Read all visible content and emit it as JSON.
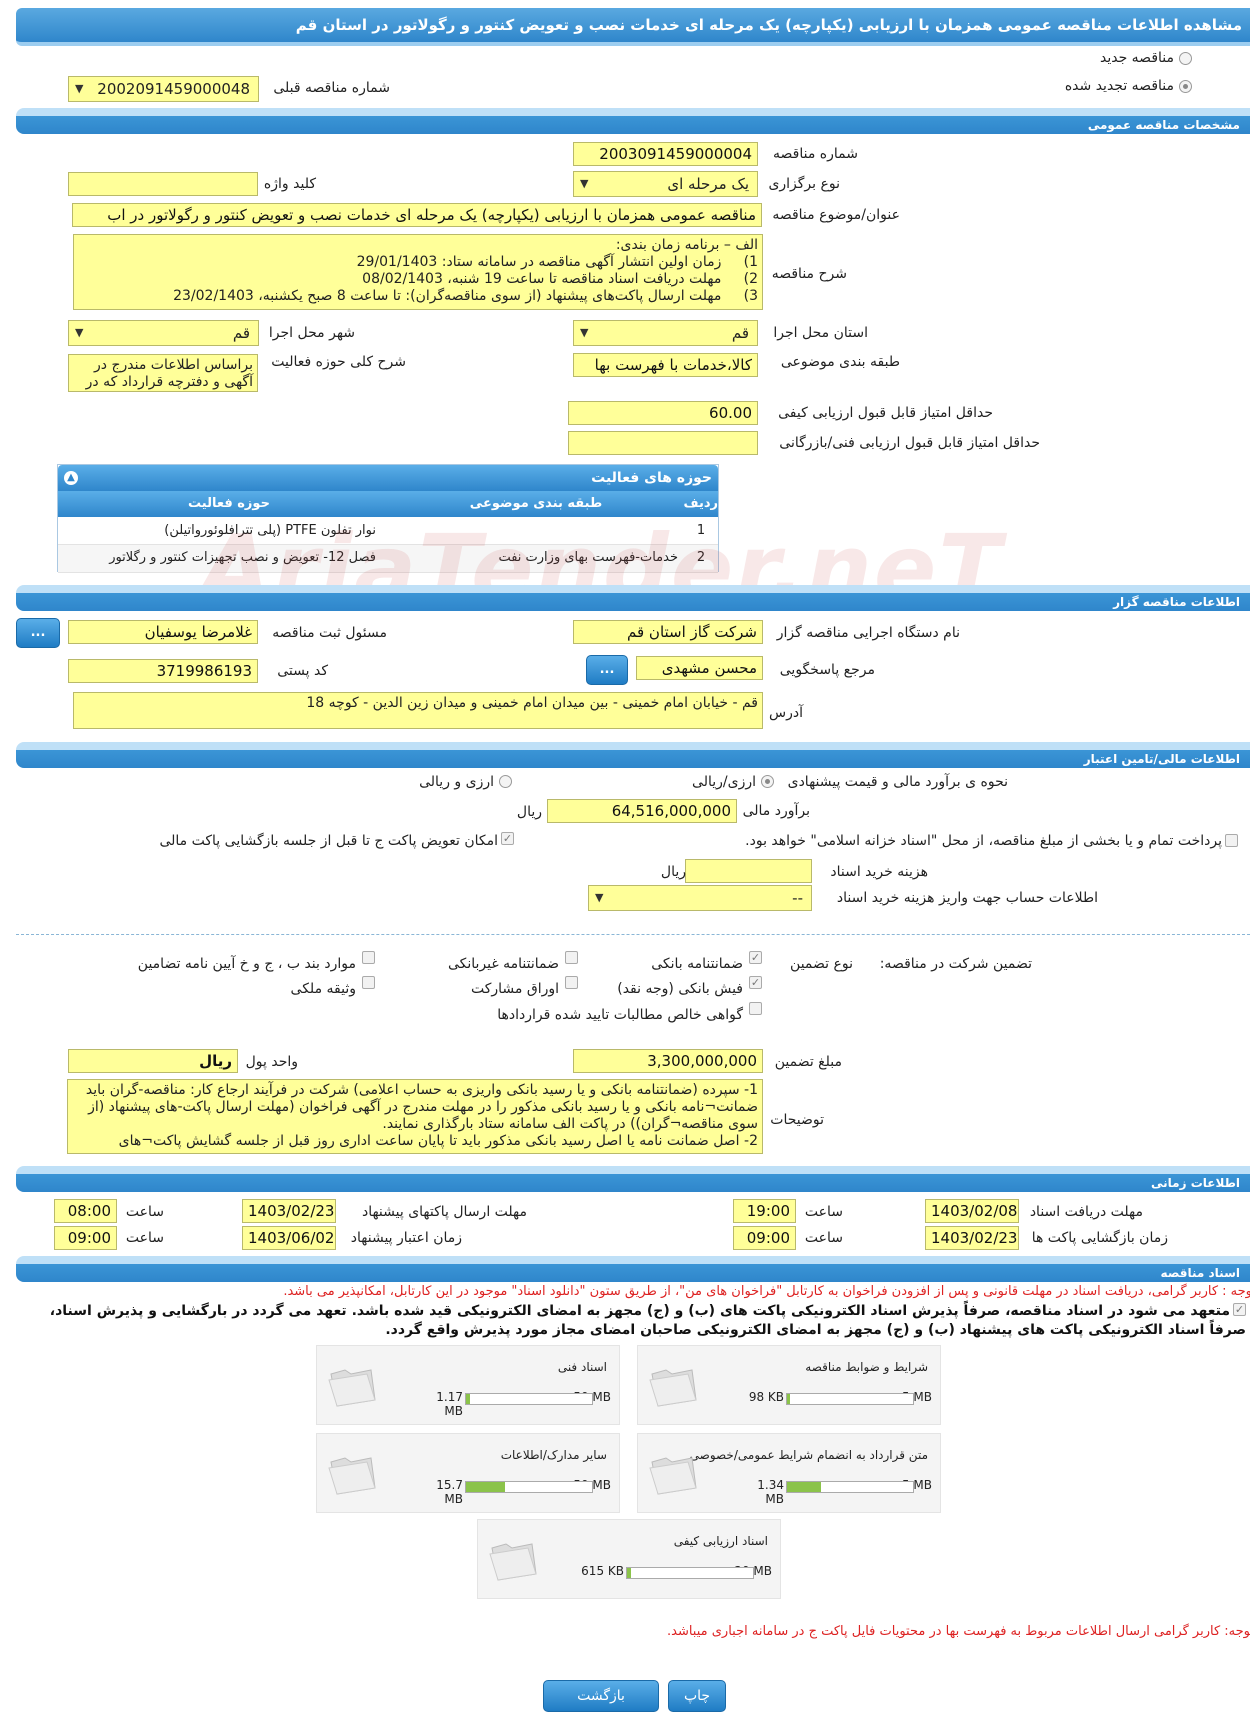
{
  "title": "مشاهده اطلاعات مناقصه عمومی همزمان با ارزیابی (یکپارچه) یک مرحله ای خدمات نصب و تعویض کنتور و رگولاتور در استان قم",
  "top": {
    "new_label": "مناقصه جدید",
    "renewed_label": "مناقصه تجدید شده",
    "prev_label": "شماره مناقصه قبلی",
    "prev_value": "2002091459000048"
  },
  "general": {
    "section": "مشخصات مناقصه عمومی",
    "number_label": "شماره مناقصه",
    "number": "2003091459000004",
    "type_label": "نوع برگزاری",
    "type": "یک مرحله ای",
    "keyword_label": "کلید واژه",
    "keyword": "",
    "subject_label": "عنوان/موضوع مناقصه",
    "subject": "مناقصه عمومی همزمان با ارزیابی (یکپارچه) یک مرحله ای خدمات نصب و تعویض کنتور و رگولاتور در اب",
    "desc_label": "شرح مناقصه",
    "desc": "الف – برنامه زمان بندی:\n1)     زمان اولین انتشار آگهی مناقصه در سامانه ستاد: 29/01/1403\n2)     مهلت دریافت اسناد مناقصه تا ساعت 19 شنبه، 08/02/1403\n3)     مهلت ارسال پاکت‌های پیشنهاد (از سوی مناقصه‌گران): تا ساعت 8 صبح یکشنبه، 23/02/1403",
    "province_label": "استان محل اجرا",
    "province": "قم",
    "city_label": "شهر محل اجرا",
    "city": "قم",
    "category_label": "طبقه بندی موضوعی",
    "category": "کالا،خدمات با فهرست بها",
    "scope_label": "شرح کلی حوزه فعالیت",
    "scope": "براساس اطلاعات مندرج در آگهی و دفترچه قرارداد که در",
    "min_quality_label": "حداقل امتیاز قابل قبول ارزیابی کیفی",
    "min_quality": "60.00",
    "min_tech_label": "حداقل امتیاز قابل قبول ارزیابی فنی/بازرگانی",
    "min_tech": ""
  },
  "activities": {
    "title": "حوزه های فعالیت",
    "headers": [
      "ردیف",
      "طبقه بندی موضوعی",
      "حوزه فعالیت"
    ],
    "rows": [
      [
        "1",
        "",
        "نوار تفلون PTFE (پلی تترافلوئورواتیلن)"
      ],
      [
        "2",
        "خدمات-فهرست بهای وزارت نفت",
        "فصل 12- تعویض و نصب تجهیزات کنتور و رگلاتور"
      ]
    ]
  },
  "organizer": {
    "section": "اطلاعات مناقصه گزار",
    "org_label": "نام دستگاه اجرایی مناقصه گزار",
    "org": "شرکت گاز استان قم",
    "resp_label": "مسئول ثبت مناقصه",
    "resp": "غلامرضا یوسفیان",
    "ref_label": "مرجع پاسخگویی",
    "ref": "محسن مشهدی",
    "postal_label": "کد پستی",
    "postal": "3719986193",
    "address_label": "آدرس",
    "address": "قم - خیابان امام خمینی - بین میدان امام خمینی و میدان زین الدین - کوچه 18",
    "dots": "..."
  },
  "finance": {
    "section": "اطلاعات مالی/تامین اعتبار",
    "method_label": "نحوه ی برآورد مالی و قیمت پیشنهادی",
    "opt1": "ارزی/ریالی",
    "opt2": "ارزی و ریالی",
    "estimate_label": "برآورد مالی",
    "estimate": "64,516,000,000",
    "rial": "ریال",
    "treasury": "پرداخت تمام و یا بخشی از مبلغ مناقصه، از محل \"اسناد خزانه اسلامی\" خواهد بود.",
    "swap": "امکان تعویض پاکت ج تا قبل از جلسه بازگشایی پاکت مالی",
    "doc_cost_label": "هزینه خرید اسناد",
    "doc_cost": "",
    "account_label": "اطلاعات حساب جهت واریز هزینه خرید اسناد",
    "account": "--"
  },
  "guarantee": {
    "label": "تضمین شرکت در مناقصه:",
    "type_label": "نوع تضمین",
    "items": [
      "ضمانتنامه بانکی",
      "ضمانتنامه غیربانکی",
      "موارد بند ب ، ج و خ آیین نامه تضامین",
      "فیش بانکی (وجه نقد)",
      "اوراق مشارکت",
      "وثیقه ملکی",
      "گواهی خالص مطالبات تایید شده قراردادها"
    ],
    "amount_label": "مبلغ تضمین",
    "amount": "3,300,000,000",
    "unit_label": "واحد پول",
    "unit": "ریال",
    "notes_label": "توضیحات",
    "notes": "1- سپرده (ضمانتنامه بانکی و یا رسید بانکی واریزی به حساب اعلامی) شرکت در فرآیند ارجاع کار: مناقصه-گران باید ضمانت¬نامه بانکی و یا رسید بانکی مذکور را در مهلت مندرج در آگهی فراخوان (مهلت ارسال پاکت-های پیشنهاد (از سوی مناقصه¬گران)) در پاکت الف سامانه ستاد بارگذاری نمایند.\n2- اصل ضمانت نامه یا اصل رسید بانکی مذکور باید تا پایان ساعت اداری روز قبل از جلسه گشایش پاکت¬های"
  },
  "timing": {
    "section": "اطلاعات زمانی",
    "doc_deadline_label": "مهلت دریافت اسناد",
    "doc_deadline": "1403/02/08",
    "time_label": "ساعت",
    "doc_time": "19:00",
    "submit_label": "مهلت ارسال پاکتهای پیشنهاد",
    "submit": "1403/02/23",
    "submit_time": "08:00",
    "open_label": "زمان بازگشایی پاکت ها",
    "open": "1403/02/23",
    "open_time": "09:00",
    "valid_label": "زمان اعتبار پیشنهاد",
    "valid": "1403/06/02",
    "valid_time": "09:00"
  },
  "docs": {
    "section": "اسناد مناقصه",
    "note1": "توجه : کاربر گرامی، دریافت اسناد در مهلت قانونی و پس از افزودن فراخوان به کارتابل \"فراخوان های من\"، از طریق ستون \"دانلود اسناد\" موجود در این کارتابل، امکانپذیر می باشد.",
    "commit1": "متعهد می شود در اسناد مناقصه، صرفاً پذیرش اسناد الکترونیکی پاکت های (ب) و (ج) مجهز به امضای الکترونیکی قید شده باشد. تعهد می گردد در بارگشایی و پذیرش اسناد،",
    "commit2": "صرفاً اسناد الکترونیکی پاکت های پیشنهاد (ب) و (ج) مجهز به امضای الکترونیکی صاحبان امضای مجاز مورد پذیرش واقع گردد.",
    "files": [
      {
        "name": "شرایط و ضوابط مناقصه",
        "used": "98 KB",
        "max": "5 MB",
        "pct": 0.02
      },
      {
        "name": "اسناد فنی",
        "used": "1.17 MB",
        "max": "50 MB",
        "pct": 0.03
      },
      {
        "name": "متن قرارداد به انضمام شرایط عمومی/خصوصی",
        "used": "1.34 MB",
        "max": "5 MB",
        "pct": 0.27
      },
      {
        "name": "سایر مدارک/اطلاعات",
        "used": "15.7 MB",
        "max": "50 MB",
        "pct": 0.31
      },
      {
        "name": "اسناد ارزیابی کیفی",
        "used": "615 KB",
        "max": "20 MB",
        "pct": 0.03
      }
    ],
    "note2": "توجه: کاربر گرامی ارسال اطلاعات مربوط به فهرست بها در محتویات فایل پاکت ج در سامانه اجباری میباشد."
  },
  "buttons": {
    "print": "چاپ",
    "back": "بازگشت"
  },
  "watermark": "AriaTender.neT"
}
